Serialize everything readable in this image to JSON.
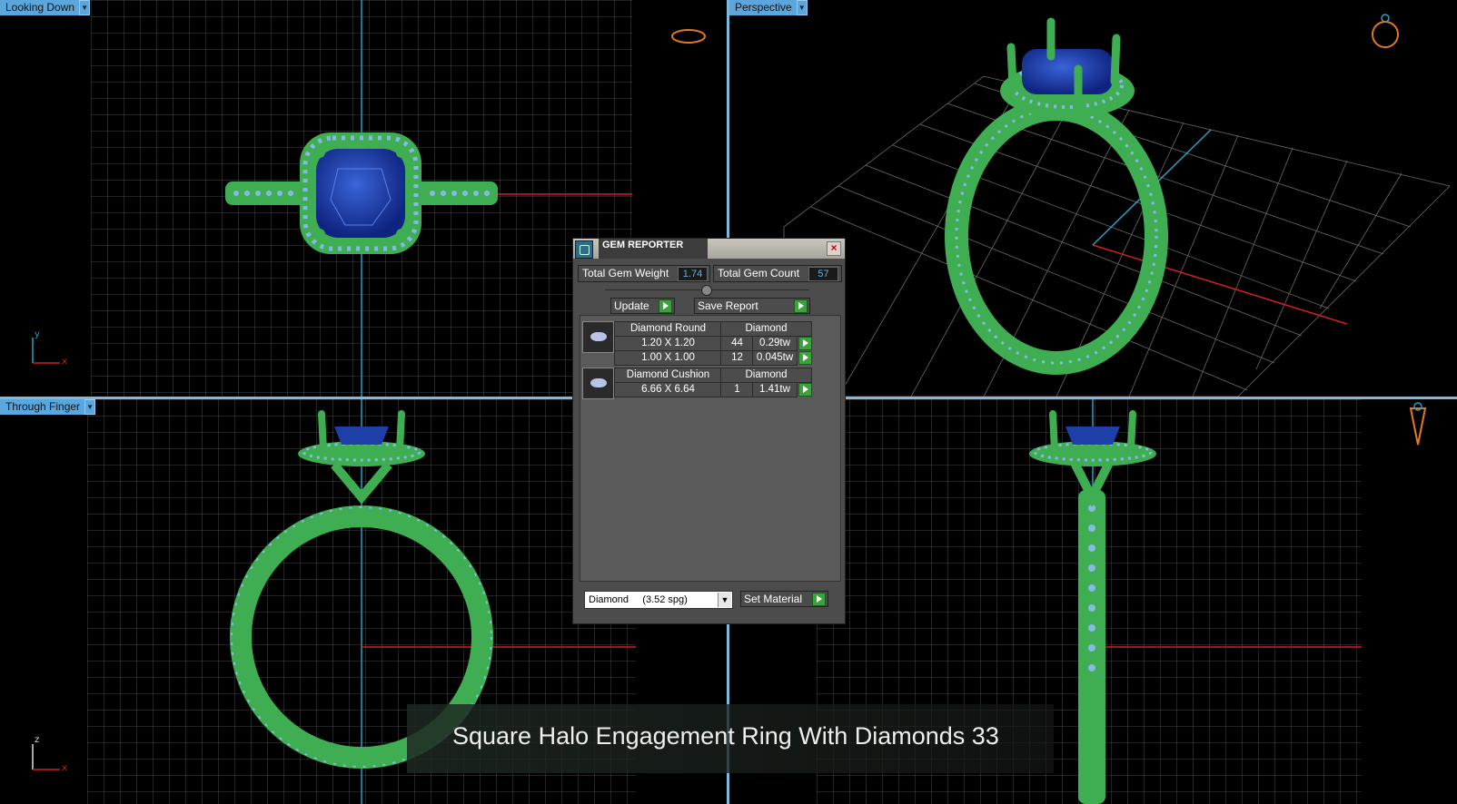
{
  "viewports": {
    "top_left": {
      "label": "Looking Down"
    },
    "top_right": {
      "label": "Perspective"
    },
    "bottom_left": {
      "label": "Through Finger"
    },
    "bottom_right": {
      "label": ""
    }
  },
  "axes": {
    "y": "y",
    "x": "x",
    "z": "z"
  },
  "gem_reporter": {
    "title": "GEM REPORTER",
    "close": "×",
    "total_gem_weight_label": "Total Gem Weight",
    "total_gem_weight": "1.74",
    "total_gem_count_label": "Total Gem Count",
    "total_gem_count": "57",
    "update_label": "Update",
    "save_report_label": "Save Report",
    "groups": [
      {
        "name": "Diamond Round",
        "material": "Diamond",
        "rows": [
          {
            "size": "1.20 X 1.20",
            "count": "44",
            "weight": "0.29tw"
          },
          {
            "size": "1.00 X 1.00",
            "count": "12",
            "weight": "0.045tw"
          }
        ]
      },
      {
        "name": "Diamond Cushion",
        "material": "Diamond",
        "rows": [
          {
            "size": "6.66 X 6.64",
            "count": "1",
            "weight": "1.41tw"
          }
        ]
      }
    ],
    "material_select": "Diamond     (3.52 spg)",
    "set_material_label": "Set Material"
  },
  "caption": "Square Halo Engagement Ring With Diamonds 33",
  "colors": {
    "metal": "#3fae52",
    "gem": "#1f3fa8",
    "grid": "#7a7a7a",
    "viewport_label": "#5ba6dc",
    "x_axis": "#d02020",
    "y_axis": "#2aa0c0"
  }
}
